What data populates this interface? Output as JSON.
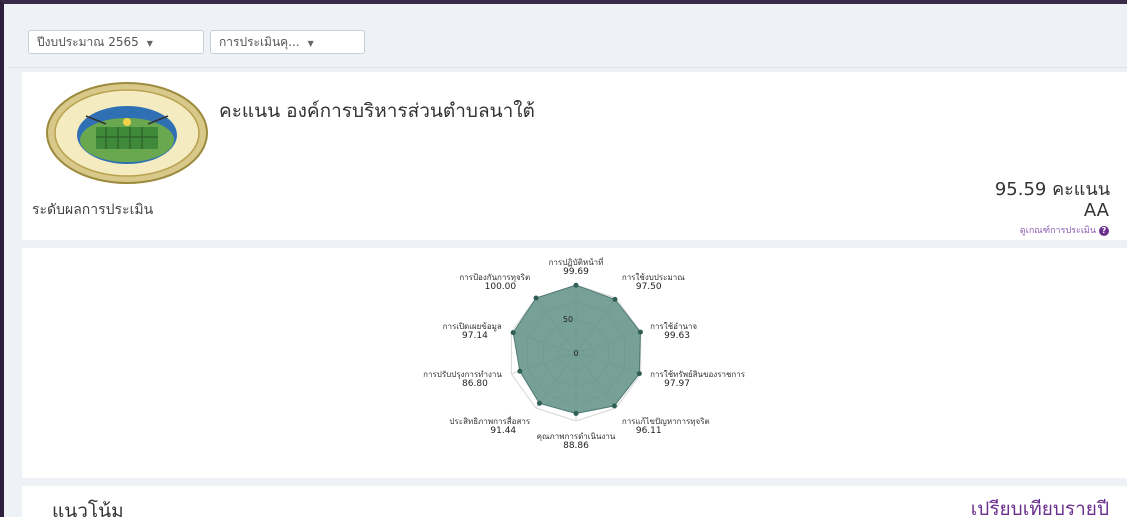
{
  "filters": {
    "year": "ปีงบประมาณ 2565",
    "assessment": "การประเมินคุ..."
  },
  "score_card": {
    "title": "คะแนน องค์การบริหารส่วนตำบลนาใต้",
    "level_label": "ระดับผลการประเมิน",
    "score": "95.59 คะแนน",
    "grade": "AA",
    "criteria_link": "ดูเกณฑ์การประเมิน",
    "seal_text": "อบต.นาใต้ อ.บ้านแท่นคิม จ.สุราษฎร์ธานี"
  },
  "chart_data": {
    "type": "radar",
    "title": "",
    "rlim": [
      0,
      100
    ],
    "ticks": [
      "0",
      "50"
    ],
    "categories": [
      "การปฏิบัติหน้าที่",
      "การใช้งบประมาณ",
      "การใช้อำนาจ",
      "การใช้ทรัพย์สินของราชการ",
      "การแก้ไขปัญหาการทุจริต",
      "คุณภาพการดำเนินงาน",
      "ประสิทธิภาพการสื่อสาร",
      "การปรับปรุงการทำงาน",
      "การเปิดเผยข้อมูล",
      "การป้องกันการทุจริต"
    ],
    "values": [
      99.69,
      97.5,
      99.63,
      97.97,
      96.11,
      88.86,
      91.44,
      86.8,
      97.14,
      100.0
    ],
    "value_labels": [
      "99.69",
      "97.50",
      "99.63",
      "97.97",
      "96.11",
      "88.86",
      "91.44",
      "86.80",
      "97.14",
      "100.00"
    ],
    "fill_color": "#5f8f85",
    "point_color": "#2f5f55"
  },
  "trend": {
    "title": "แนวโน้ม",
    "compare_link": "เปรียบเทียบรายปี"
  },
  "colors": {
    "accent": "#6b2f8e",
    "background": "#eef1f5"
  }
}
